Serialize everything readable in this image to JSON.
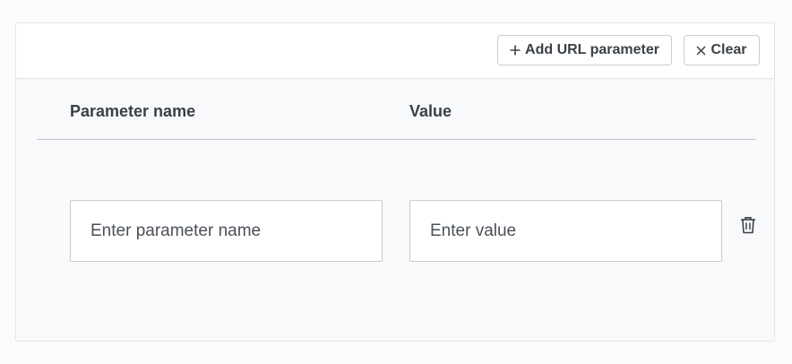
{
  "toolbar": {
    "add_label": "Add URL parameter",
    "add_icon": "plus-icon",
    "clear_label": "Clear",
    "clear_icon": "close-icon"
  },
  "table": {
    "columns": [
      "Parameter name",
      "Value"
    ],
    "rows": [
      {
        "name": {
          "value": "",
          "placeholder": "Enter parameter name"
        },
        "value": {
          "value": "",
          "placeholder": "Enter value"
        },
        "delete_icon": "trash-icon"
      }
    ]
  },
  "colors": {
    "text": "#3a4048",
    "border": "#c6c9ce",
    "panel_bg": "#f8f9fb",
    "toolbar_bg": "#ffffff"
  }
}
